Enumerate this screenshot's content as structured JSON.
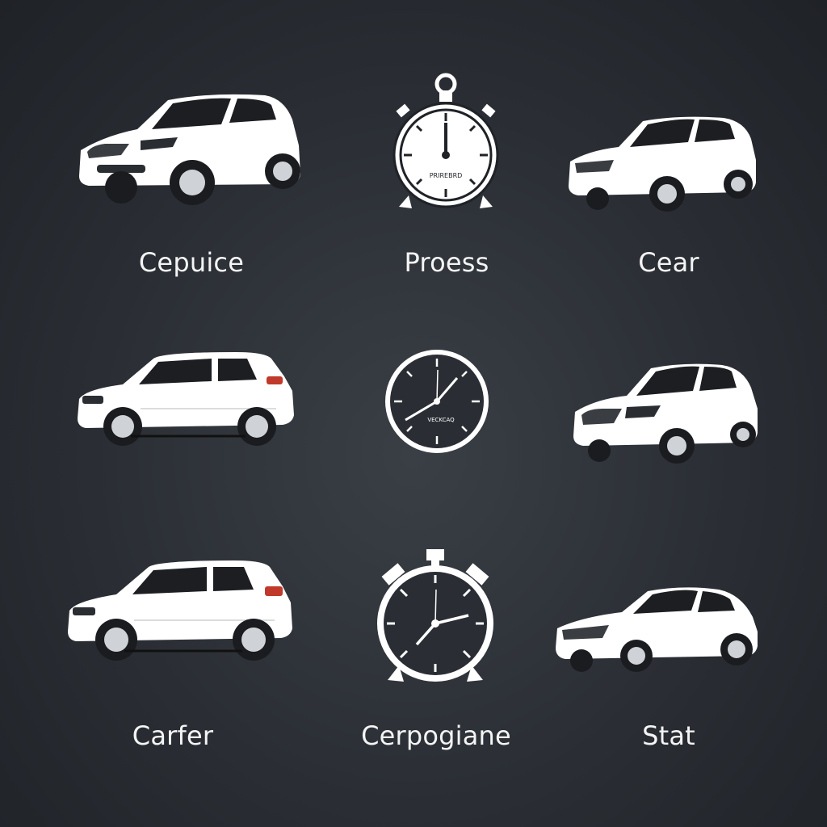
{
  "labels": {
    "r1c1": "Cepuice",
    "r1c2": "Proess",
    "r1c3": "Cear",
    "r3c1": "Carfer",
    "r3c2": "Cerpogiane",
    "r3c3": "Stat"
  },
  "stopwatch_top": {
    "label": "PRIREBRD"
  },
  "clock_middle": {
    "label": "VECKCAQ"
  },
  "colors": {
    "background": "#2a2e34",
    "foreground": "#ffffff"
  }
}
